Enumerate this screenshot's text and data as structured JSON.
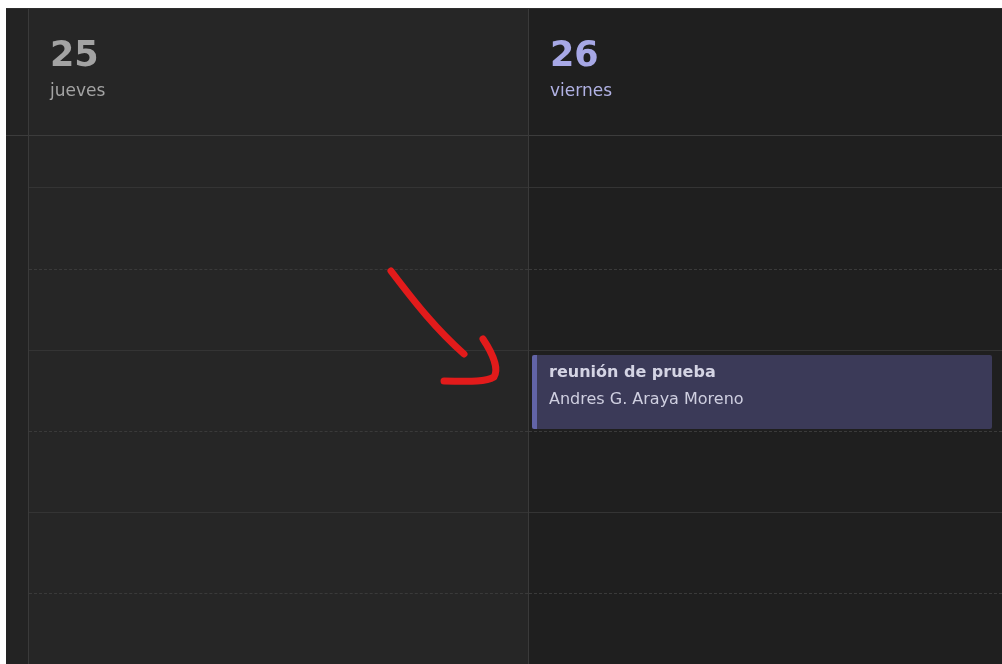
{
  "days": [
    {
      "number": "25",
      "weekday": "jueves",
      "today": false
    },
    {
      "number": "26",
      "weekday": "viernes",
      "today": true,
      "events": [
        {
          "title": "reunión de prueba",
          "organizer": "Andres G. Araya Moreno"
        }
      ]
    }
  ]
}
